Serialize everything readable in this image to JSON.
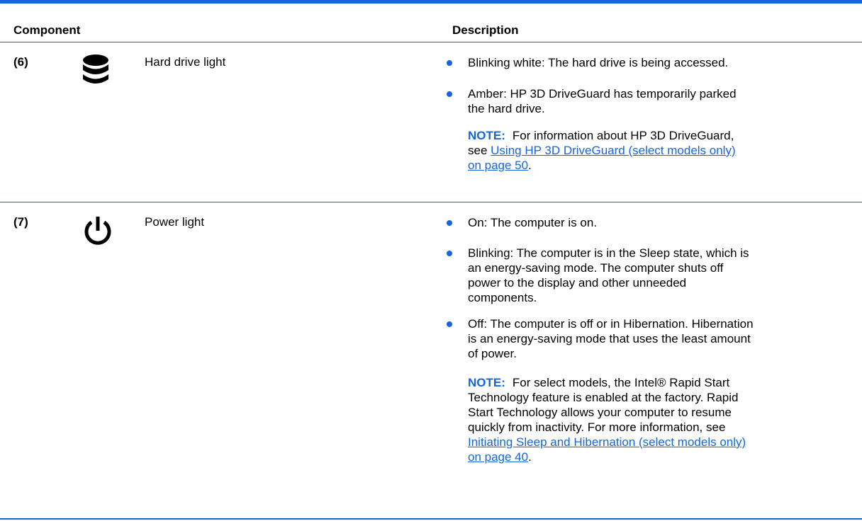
{
  "header": {
    "component_label": "Component",
    "description_label": "Description"
  },
  "colors": {
    "accent": "#1565e0",
    "text": "#000000",
    "background": "#ffffff"
  },
  "rows": [
    {
      "number": "(6)",
      "icon": "hard-drive-icon",
      "name": "Hard drive light",
      "items": [
        {
          "lines": [
            "Blinking white: The hard drive is being accessed."
          ]
        },
        {
          "lines": [
            "Amber: HP 3D DriveGuard has temporarily parked",
            "the hard drive."
          ]
        }
      ],
      "note": {
        "label": "NOTE:",
        "lines": [
          "For information about HP 3D DriveGuard,",
          "see "
        ],
        "link_lines": [
          "Using HP 3D DriveGuard (select models only)",
          "on page 50"
        ],
        "after_link": "."
      }
    },
    {
      "number": "(7)",
      "icon": "power-icon",
      "name": "Power light",
      "items": [
        {
          "lines": [
            "On: The computer is on."
          ]
        },
        {
          "lines": [
            "Blinking: The computer is in the Sleep state, which is",
            "an energy-saving mode. The computer shuts off",
            "power to the display and other unneeded",
            "components."
          ]
        },
        {
          "lines": [
            "Off: The computer is off or in Hibernation. Hibernation",
            "is an energy-saving mode that uses the least amount",
            "of power."
          ]
        }
      ],
      "note": {
        "label": "NOTE:",
        "lines": [
          "For select models, the Intel® Rapid Start",
          "Technology feature is enabled at the factory. Rapid",
          "Start Technology allows your computer to resume",
          "quickly from inactivity. For more information, see"
        ],
        "link_lines": [
          "Initiating Sleep and Hibernation (select models only)",
          "on page 40"
        ],
        "after_link": "."
      }
    }
  ]
}
